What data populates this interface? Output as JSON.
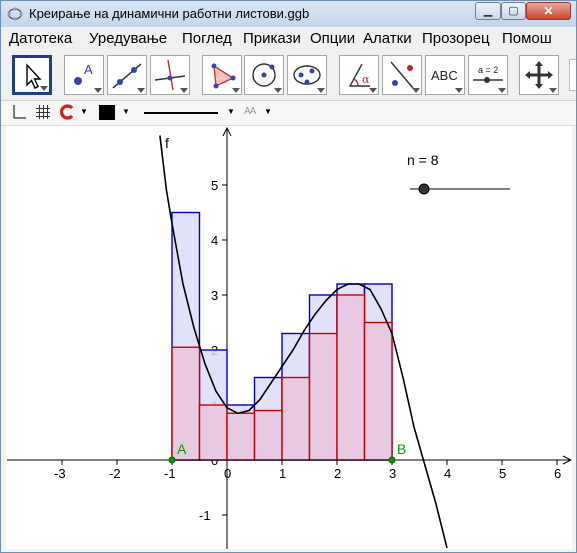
{
  "window": {
    "title": "Креирање на динамични работни листови.ggb",
    "min_icon": "minimize-icon",
    "max_icon": "maximize-icon",
    "close_icon": "close-icon"
  },
  "menu": [
    "Датотека",
    "Уредување",
    "Поглед",
    "Прикази",
    "Опции",
    "Алатки",
    "Прозорец",
    "Помош"
  ],
  "toolbar": {
    "tools": [
      "move-tool",
      "point-tool",
      "line-tool",
      "perpendicular-tool",
      "polygon-tool",
      "circle-tool",
      "conic-tool",
      "angle-tool",
      "reflect-tool",
      "text-tool",
      "slider-tool",
      "move-graphics-tool"
    ],
    "text_tool_label": "ABC",
    "slider_tool_label": "a = 2",
    "angle_label": "α"
  },
  "stylebar": {
    "axes_icon": "axes-icon",
    "grid_icon": "grid-icon",
    "magnet_icon": "point-capture-icon",
    "color_swatch": "#000000",
    "line_style_icon": "line-style-icon",
    "label_style": "AA"
  },
  "graphics": {
    "function_label": "f",
    "slider_label": "n = 8",
    "slider_value": 8,
    "point_a_label": "A",
    "point_b_label": "B",
    "colors": {
      "curve": "#000000",
      "upper_sum": "#0000cc",
      "upper_fill": "#dcdcf8",
      "lower_sum": "#cc0000",
      "lower_fill": "#e8c6de",
      "points": "#00a000"
    }
  },
  "chart_data": {
    "type": "line",
    "function_label": "f",
    "xlim": [
      -3.9,
      6.2
    ],
    "ylim": [
      -1.6,
      5.9
    ],
    "x_ticks": [
      -3,
      -2,
      -1,
      0,
      1,
      2,
      3,
      4,
      5,
      6
    ],
    "y_ticks": [
      -1,
      0,
      1,
      2,
      3,
      4,
      5
    ],
    "interval": [
      -1,
      3
    ],
    "n": 8,
    "upper_sum_heights": [
      4.5,
      2.0,
      1.0,
      1.5,
      2.3,
      3.0,
      3.2,
      3.2
    ],
    "lower_sum_heights": [
      2.05,
      1.0,
      0.85,
      0.9,
      1.5,
      2.3,
      3.0,
      2.5
    ],
    "curve_points": [
      [
        -1.22,
        5.9
      ],
      [
        -1.1,
        4.9
      ],
      [
        -1.0,
        4.3
      ],
      [
        -0.8,
        3.2
      ],
      [
        -0.6,
        2.4
      ],
      [
        -0.4,
        1.75
      ],
      [
        -0.2,
        1.25
      ],
      [
        0.0,
        0.95
      ],
      [
        0.2,
        0.85
      ],
      [
        0.4,
        0.9
      ],
      [
        0.6,
        1.1
      ],
      [
        0.8,
        1.4
      ],
      [
        1.0,
        1.7
      ],
      [
        1.2,
        2.0
      ],
      [
        1.4,
        2.35
      ],
      [
        1.6,
        2.65
      ],
      [
        1.8,
        2.9
      ],
      [
        2.0,
        3.1
      ],
      [
        2.2,
        3.2
      ],
      [
        2.4,
        3.2
      ],
      [
        2.6,
        3.1
      ],
      [
        2.8,
        2.75
      ],
      [
        3.0,
        2.3
      ],
      [
        3.2,
        1.5
      ],
      [
        3.4,
        0.6
      ],
      [
        3.6,
        -0.1
      ],
      [
        3.8,
        -0.8
      ],
      [
        4.0,
        -1.6
      ]
    ]
  }
}
